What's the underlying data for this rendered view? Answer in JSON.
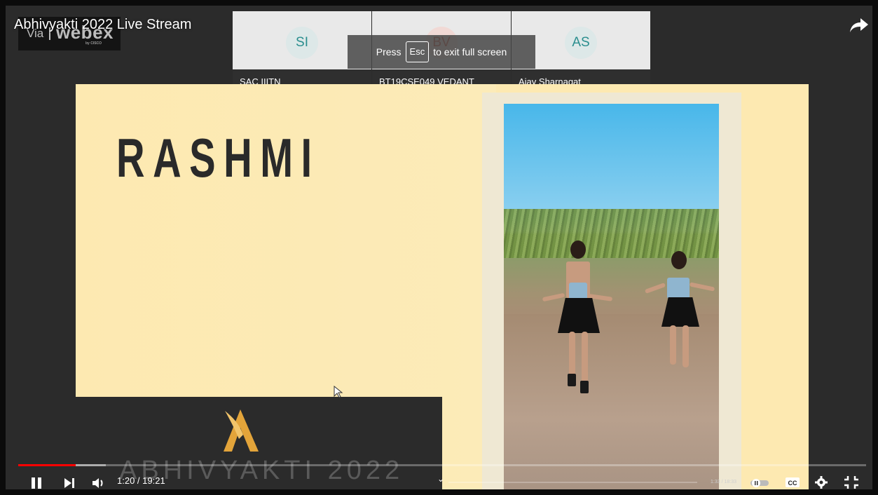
{
  "video": {
    "title": "Abhivyakti 2022 Live Stream"
  },
  "webex": {
    "via": "Via",
    "brand": "webex",
    "sub": "by CISCO"
  },
  "participants": [
    {
      "initials": "SI",
      "name": "SAC IIITN"
    },
    {
      "initials": "BV",
      "name": "BT19CSE049 VEDANT"
    },
    {
      "initials": "AS",
      "name": "Ajay Sharnagat"
    }
  ],
  "fullscreen_notice": {
    "prefix": "Press",
    "key": "Esc",
    "suffix": "to exit full screen"
  },
  "slide": {
    "performer": "RASHMI",
    "event": "ABHIVYAKTI 2022"
  },
  "player": {
    "time": "1:20 / 19:21",
    "mini_time": "1:33 / 18:33",
    "progress_played": 0.068,
    "progress_loaded": 0.103,
    "accent": "#ff0000"
  },
  "colors": {
    "slide_bg": "#fde9b1",
    "logo_gold": "#e3a43a"
  }
}
